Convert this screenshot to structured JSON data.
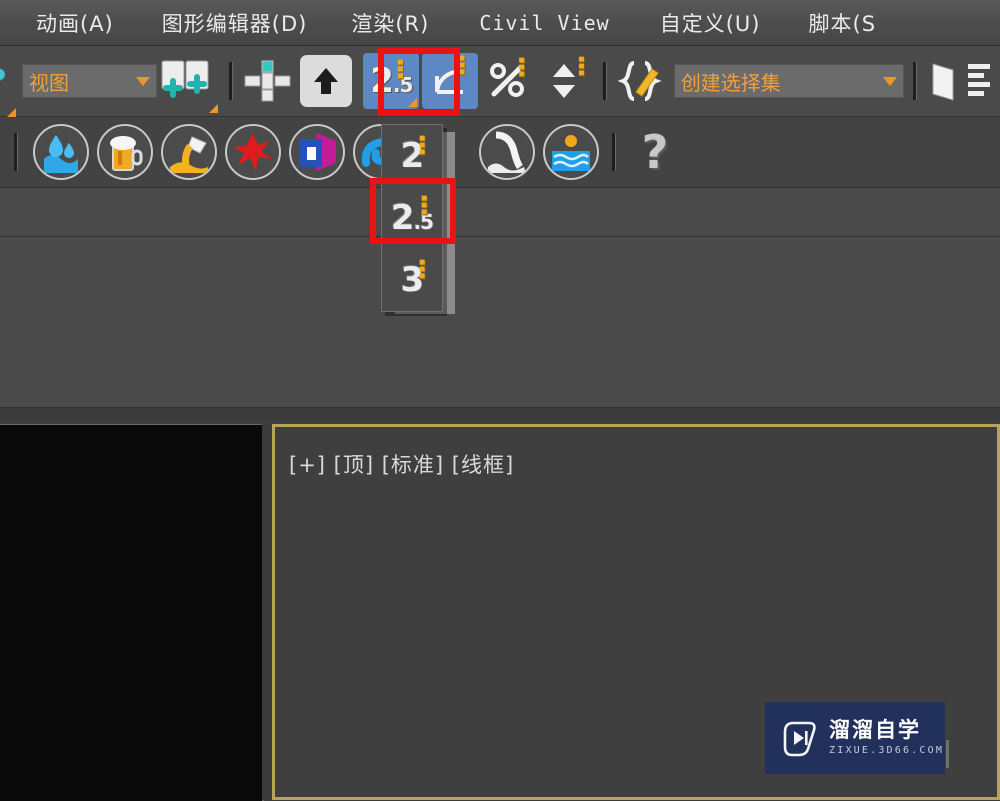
{
  "app": {
    "name": "3ds Max",
    "accent_blue": "#5d88c4",
    "accent_orange": "#f0a03c",
    "annotation_red": "#ee1111",
    "viewport_border": "#b9a25a"
  },
  "menubar": {
    "items": [
      {
        "label": "动画(A)",
        "name": "menu-animation",
        "latin": false
      },
      {
        "label": "图形编辑器(D)",
        "name": "menu-graph-editor",
        "latin": false
      },
      {
        "label": "渲染(R)",
        "name": "menu-render",
        "latin": false
      },
      {
        "label": "Civil View",
        "name": "menu-civil-view",
        "latin": true
      },
      {
        "label": "自定义(U)",
        "name": "menu-customize",
        "latin": false
      },
      {
        "label": "脚本(S",
        "name": "menu-scripting",
        "latin": false
      }
    ]
  },
  "toolbar_main": {
    "reference_coordinate_system": {
      "value": "视图",
      "placeholder": "视图",
      "name": "coordinate-system-combo"
    },
    "selection_set": {
      "value": "创建选择集",
      "placeholder": "创建选择集",
      "name": "named-selection-set-combo"
    },
    "buttons": [
      {
        "name": "use-center-flyout-icon",
        "label": "使用轴点中心",
        "glyph": "axis-center"
      },
      {
        "name": "select-and-manipulate-icon",
        "label": "选择并操纵",
        "glyph": "manipulate"
      },
      {
        "name": "snap-toggle-2_5",
        "label": "2.5",
        "sublabel": ".5",
        "active": true
      },
      {
        "name": "angle-snap-toggle",
        "label": "角度捕捉切换",
        "glyph": "angle"
      },
      {
        "name": "percent-snap-toggle",
        "label": "百分比捕捉切换",
        "glyph": "percent"
      },
      {
        "name": "spinner-snap-toggle",
        "label": "微调器捕捉切换",
        "glyph": "spinner"
      },
      {
        "name": "edit-named-selection-sets",
        "label": "编辑命名选择集",
        "glyph": "braces-pencil"
      },
      {
        "name": "mirror-icon",
        "label": "镜像",
        "glyph": "mirror"
      },
      {
        "name": "align-icon",
        "label": "对齐",
        "glyph": "align"
      }
    ]
  },
  "toolbar_plugins": {
    "icons": [
      {
        "name": "realflow-water-icon",
        "label": "水",
        "glyph": "💧"
      },
      {
        "name": "realflow-beer-icon",
        "label": "啤酒",
        "glyph": "🍺"
      },
      {
        "name": "realflow-honey-icon",
        "label": "蜂蜜",
        "glyph": "🍯"
      },
      {
        "name": "realflow-splash-red-icon",
        "label": "飞溅",
        "glyph": "✳"
      },
      {
        "name": "realflow-container-icon",
        "label": "容器",
        "glyph": "◩"
      },
      {
        "name": "realflow-wave-icon",
        "label": "波浪",
        "glyph": "🌊"
      },
      {
        "name": "realflow-waterfall-icon",
        "label": "瀑布",
        "glyph": "⛰"
      },
      {
        "name": "realflow-ocean-icon",
        "label": "海洋",
        "glyph": "🌅"
      },
      {
        "name": "help-question-icon",
        "label": "?",
        "glyph": "?"
      }
    ]
  },
  "snap_flyout": {
    "name": "snap-toggle-flyout",
    "items": [
      {
        "name": "snap-option-2d",
        "label": "2",
        "sublabel": "",
        "highlighted": false
      },
      {
        "name": "snap-option-2_5d",
        "label": "2",
        "sublabel": ".5",
        "highlighted": true
      },
      {
        "name": "snap-option-3d",
        "label": "3",
        "sublabel": "",
        "highlighted": false
      }
    ]
  },
  "annotations": [
    {
      "name": "annotation-box-toolbar-snap",
      "color": "#ee1111"
    },
    {
      "name": "annotation-box-flyout-snap",
      "color": "#ee1111"
    }
  ],
  "viewport": {
    "label": "[+] [顶] [标准] [线框]",
    "name": "viewport-top-wireframe",
    "active": true
  },
  "watermark": {
    "title": "溜溜自学",
    "subtitle": "ZIXUE.3D66.COM",
    "name": "watermark-liuliu-zixue"
  }
}
